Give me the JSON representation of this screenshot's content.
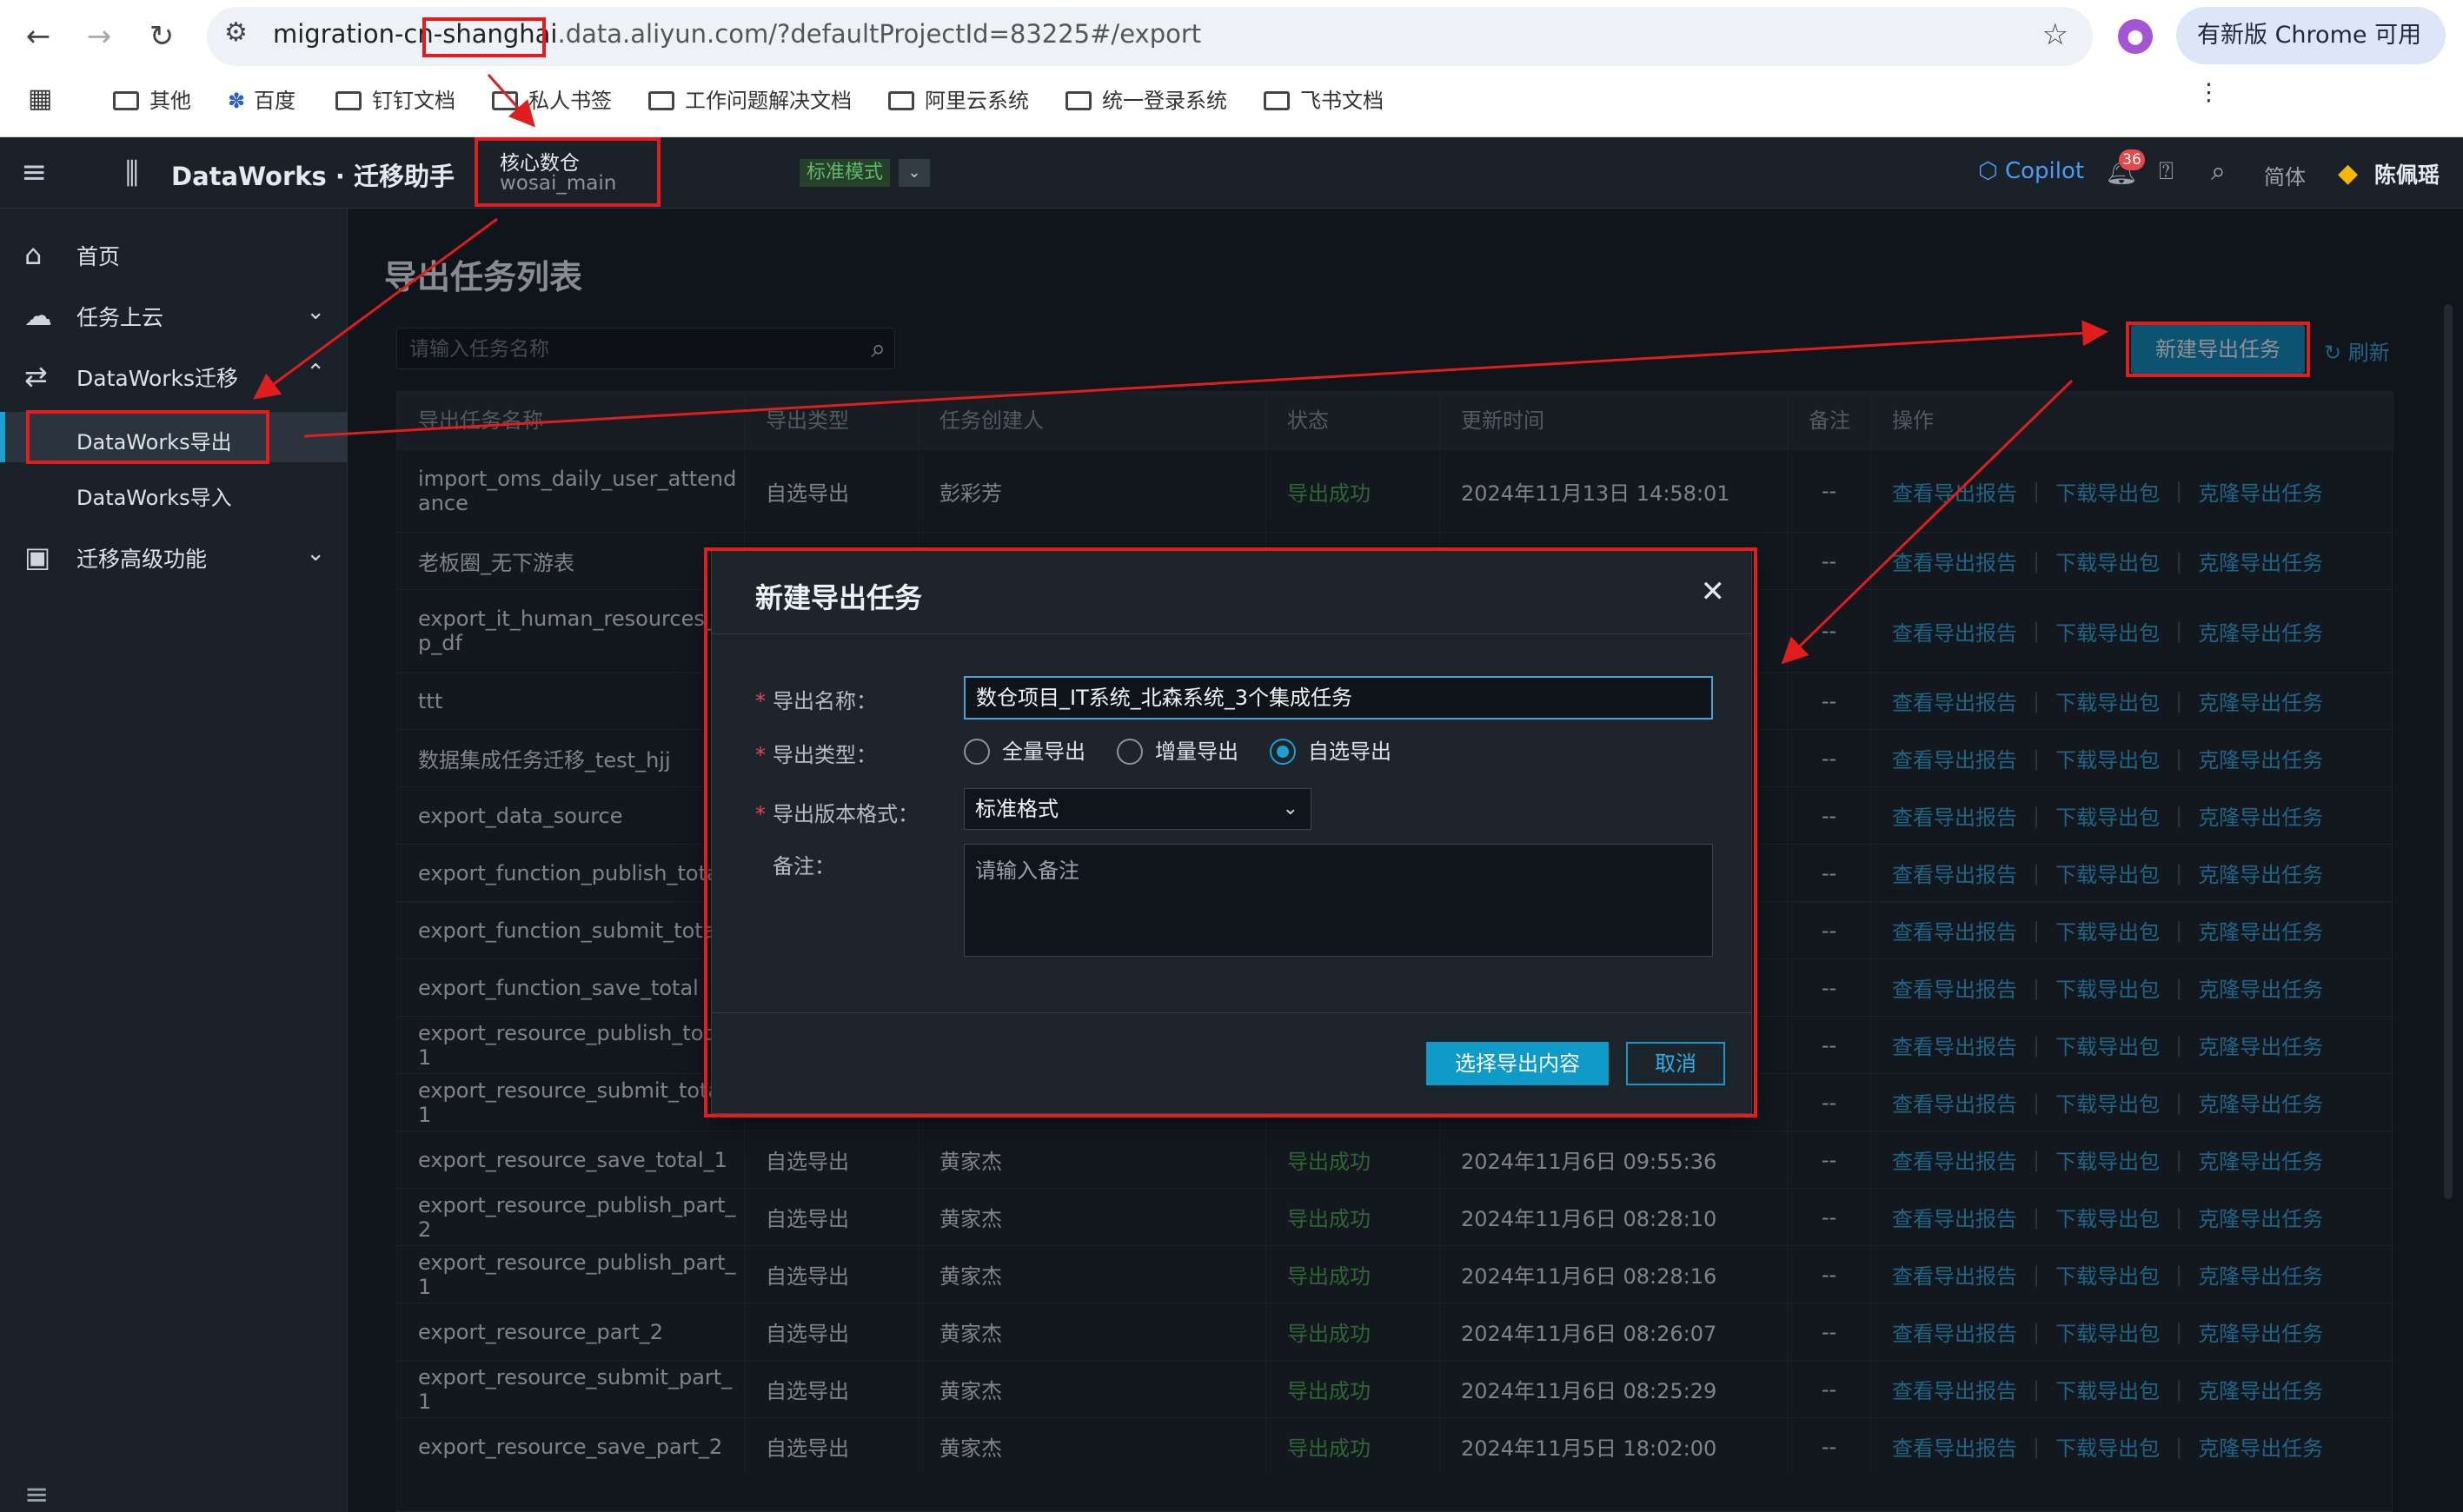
{
  "browser": {
    "url_prefix": "migration-cn-",
    "url_highlight": "shanghai",
    "url_suffix": ".data.aliyun.com/?defaultProjectId=83225#/export",
    "update_label": "有新版 Chrome 可用",
    "bookmarks": [
      "其他",
      "百度",
      "钉钉文档",
      "私人书签",
      "工作问题解决文档",
      "阿里云系统",
      "统一登录系统",
      "飞书文档"
    ]
  },
  "header": {
    "app_name": "DataWorks · 迁移助手",
    "workspace_title": "核心数仓",
    "workspace_sub": "wosai_main",
    "mode": "标准模式",
    "copilot": "Copilot",
    "notif_count": "36",
    "lang": "简体",
    "user": "陈佩瑶"
  },
  "sidebar": {
    "home": "首页",
    "task_cloud": "任务上云",
    "migration": "DataWorks迁移",
    "export": "DataWorks导出",
    "import": "DataWorks导入",
    "advanced": "迁移高级功能"
  },
  "main": {
    "title": "导出任务列表",
    "search_placeholder": "请输入任务名称",
    "new_button": "新建导出任务",
    "refresh": "刷新",
    "columns": [
      "导出任务名称",
      "导出类型",
      "任务创建人",
      "状态",
      "更新时间",
      "备注",
      "操作"
    ],
    "ops": [
      "查看导出报告",
      "下载导出包",
      "克隆导出任务"
    ],
    "rows": [
      {
        "name": "import_oms_daily_user_attendance",
        "type": "自选导出",
        "creator": "彭彩芳",
        "status": "导出成功",
        "time": "2024年11月13日 14:58:01",
        "note": "--"
      },
      {
        "name": "老板圈_无下游表",
        "type": "",
        "creator": "",
        "status": "",
        "time": "",
        "note": "--"
      },
      {
        "name": "export_it_human_resources_dep_df",
        "type": "",
        "creator": "",
        "status": "",
        "time": "",
        "note": "--"
      },
      {
        "name": "ttt",
        "type": "",
        "creator": "",
        "status": "",
        "time": "",
        "note": "--"
      },
      {
        "name": "数据集成任务迁移_test_hjj",
        "type": "",
        "creator": "",
        "status": "",
        "time": "",
        "note": "--"
      },
      {
        "name": "export_data_source",
        "type": "",
        "creator": "",
        "status": "",
        "time": "",
        "note": "--"
      },
      {
        "name": "export_function_publish_total",
        "type": "",
        "creator": "",
        "status": "",
        "time": "",
        "note": "--"
      },
      {
        "name": "export_function_submit_total",
        "type": "",
        "creator": "",
        "status": "",
        "time": "",
        "note": "--"
      },
      {
        "name": "export_function_save_total",
        "type": "",
        "creator": "",
        "status": "",
        "time": "",
        "note": "--"
      },
      {
        "name": "export_resource_publish_total_1",
        "type": "",
        "creator": "",
        "status": "",
        "time": "",
        "note": "--"
      },
      {
        "name": "export_resource_submit_total_1",
        "type": "",
        "creator": "",
        "status": "",
        "time": "",
        "note": "--"
      },
      {
        "name": "export_resource_save_total_1",
        "type": "自选导出",
        "creator": "黄家杰",
        "status": "导出成功",
        "time": "2024年11月6日 09:55:36",
        "note": "--"
      },
      {
        "name": "export_resource_publish_part_2",
        "type": "自选导出",
        "creator": "黄家杰",
        "status": "导出成功",
        "time": "2024年11月6日 08:28:10",
        "note": "--"
      },
      {
        "name": "export_resource_publish_part_1",
        "type": "自选导出",
        "creator": "黄家杰",
        "status": "导出成功",
        "time": "2024年11月6日 08:28:16",
        "note": "--"
      },
      {
        "name": "export_resource_part_2",
        "type": "自选导出",
        "creator": "黄家杰",
        "status": "导出成功",
        "time": "2024年11月6日 08:26:07",
        "note": "--"
      },
      {
        "name": "export_resource_submit_part_1",
        "type": "自选导出",
        "creator": "黄家杰",
        "status": "导出成功",
        "time": "2024年11月6日 08:25:29",
        "note": "--"
      },
      {
        "name": "export_resource_save_part_2",
        "type": "自选导出",
        "creator": "黄家杰",
        "status": "导出成功",
        "time": "2024年11月5日 18:02:00",
        "note": "--"
      }
    ]
  },
  "modal": {
    "title": "新建导出任务",
    "name_label": "导出名称：",
    "name_value": "数仓项目_IT系统_北森系统_3个集成任务",
    "type_label": "导出类型：",
    "type_options": [
      "全量导出",
      "增量导出",
      "自选导出"
    ],
    "selected_type": "自选导出",
    "format_label": "导出版本格式：",
    "format_value": "标准格式",
    "note_label": "备注：",
    "note_placeholder": "请输入备注",
    "confirm": "选择导出内容",
    "cancel": "取消"
  },
  "colors": {
    "accent": "#0e8bbf",
    "annotation": "#e11d1d",
    "success": "#4caf50"
  }
}
